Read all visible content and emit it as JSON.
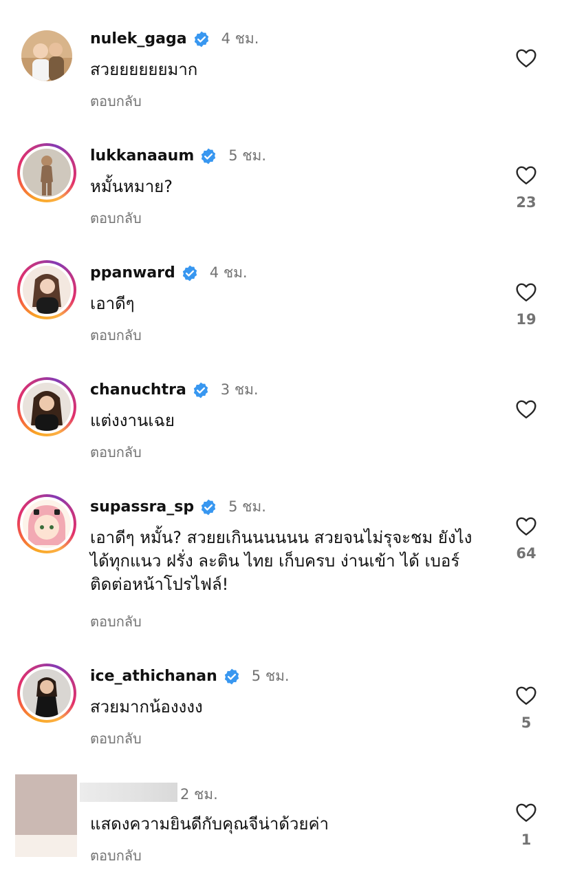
{
  "reply_label": "ตอบกลับ",
  "comments": [
    {
      "username": "nulek_gaga",
      "verified": true,
      "time": "4 ชม.",
      "text": "สวยยยยยยมาก",
      "likes": ""
    },
    {
      "username": "lukkanaaum",
      "verified": true,
      "time": "5 ชม.",
      "text": "หมั้นหมาย?",
      "likes": "23"
    },
    {
      "username": "ppanward",
      "verified": true,
      "time": "4 ชม.",
      "text": "เอาดีๆ",
      "likes": "19"
    },
    {
      "username": "chanuchtra",
      "verified": true,
      "time": "3 ชม.",
      "text": "แต่งงานเฉย",
      "likes": ""
    },
    {
      "username": "supassra_sp",
      "verified": true,
      "time": "5 ชม.",
      "text": "เอาดีๆ หมั้น? สวยยเกินนนนนน สวยจนไม่รุจะชม ยังไง ได้ทุกแนว ฝรั่ง ละติน ไทย เก็บครบ ง่านเข้า ได้ เบอร์ติดต่อหน้าโปรไฟล์!",
      "likes": "64"
    },
    {
      "username": "ice_athichanan",
      "verified": true,
      "time": "5 ชม.",
      "text": "สวยมากน้องงงง",
      "likes": "5"
    },
    {
      "username": "",
      "verified": false,
      "time": "2 ชม.",
      "text": "แสดงความยินดีกับคุณจีน่าด้วยค่า",
      "likes": "1"
    }
  ],
  "icons": {
    "like": "heart-outline-icon",
    "verified": "verified-badge-icon"
  },
  "colors": {
    "verified": "#3897f0",
    "secondary_text": "#737373"
  }
}
